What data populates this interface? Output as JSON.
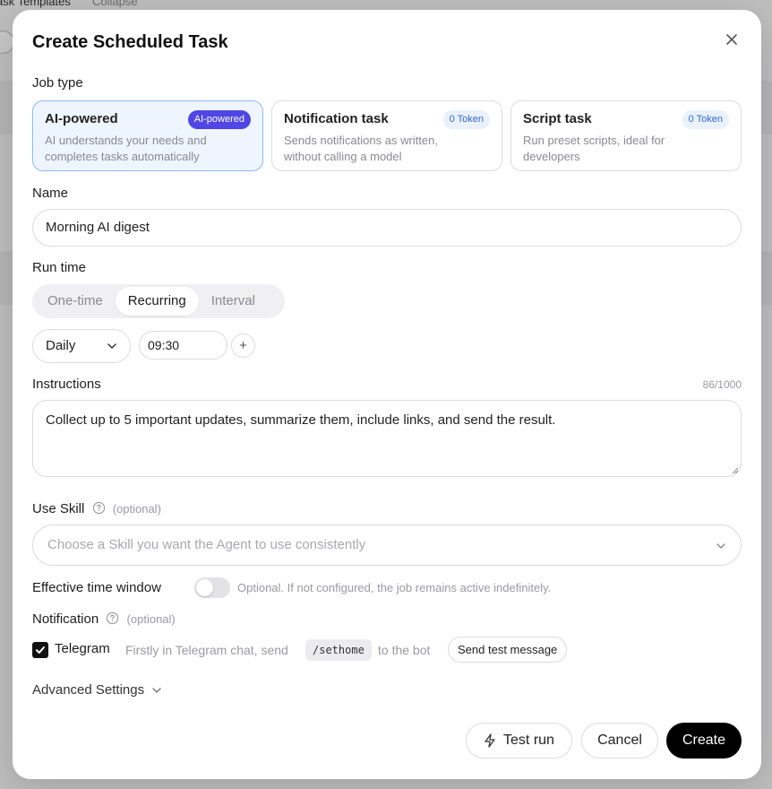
{
  "background": {
    "section_title": "ask Templates",
    "collapse_label": "Collapse"
  },
  "dialog": {
    "title": "Create Scheduled Task",
    "job_type_label": "Job type",
    "job_types": [
      {
        "title": "AI-powered",
        "badge": "AI-powered",
        "desc": "AI understands your needs and completes tasks automatically"
      },
      {
        "title": "Notification task",
        "badge": "0 Token",
        "desc": "Sends notifications as written, without calling a model"
      },
      {
        "title": "Script task",
        "badge": "0 Token",
        "desc": "Run preset scripts, ideal for developers"
      }
    ],
    "name_label": "Name",
    "name_value": "Morning AI digest",
    "run_time_label": "Run time",
    "run_time_tabs": [
      "One-time",
      "Recurring",
      "Interval"
    ],
    "frequency_value": "Daily",
    "time_value": "09:30",
    "add_time_symbol": "+",
    "instructions_label": "Instructions",
    "instructions_counter": "86/1000",
    "instructions_value": "Collect up to 5 important updates, summarize them, include links, and send the result.",
    "use_skill_label": "Use Skill",
    "use_skill_optional": "(optional)",
    "skill_placeholder": "Choose a Skill you want the Agent to use consistently",
    "effective_window_label": "Effective time window",
    "effective_window_hint": "Optional. If not configured, the job remains active indefinitely.",
    "notification_label": "Notification",
    "notification_optional": "(optional)",
    "telegram_label": "Telegram",
    "telegram_hint_1": "Firstly in Telegram chat, send",
    "telegram_command": "/sethome",
    "telegram_hint_2": "to the bot",
    "send_test_label": "Send test message",
    "advanced_label": "Advanced Settings",
    "test_run_label": "Test run",
    "cancel_label": "Cancel",
    "create_label": "Create"
  },
  "colors": {
    "accent": "#5046e5",
    "active_card_bg": "#eef5ff",
    "primary_button": "#000000"
  }
}
